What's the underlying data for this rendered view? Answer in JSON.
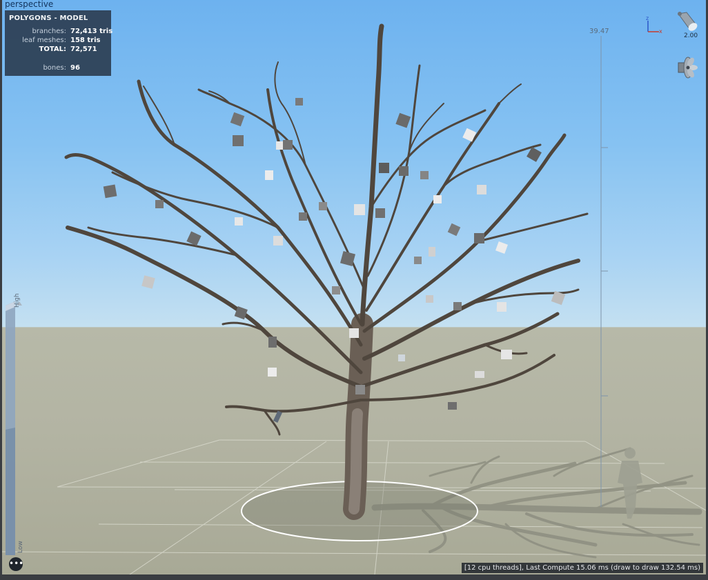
{
  "viewport": {
    "label": "perspective",
    "height_label": "39.47"
  },
  "stats": {
    "title": "POLYGONS - MODEL",
    "rows": [
      {
        "key": "branches:",
        "value": "72,413 tris"
      },
      {
        "key": "leaf meshes:",
        "value": "158 tris"
      },
      {
        "key": "TOTAL:",
        "value": "72,571"
      },
      {
        "key": "bones:",
        "value": "96"
      }
    ]
  },
  "gizmo": {
    "z_label": "z",
    "x_label": "x"
  },
  "light": {
    "intensity": "2.00"
  },
  "lod": {
    "high_label": "High",
    "low_label": "Low"
  },
  "status": {
    "text": "[12 cpu threads], Last Compute 15.06 ms (draw to draw 132.54 ms)"
  },
  "icons": {
    "light": "spotlight-icon",
    "fan": "wind-fan-icon",
    "more": "ellipsis-icon"
  },
  "colors": {
    "sky_top": "#6db2ef",
    "ground": "#b3b4a3",
    "panel": "#2c3e52"
  }
}
